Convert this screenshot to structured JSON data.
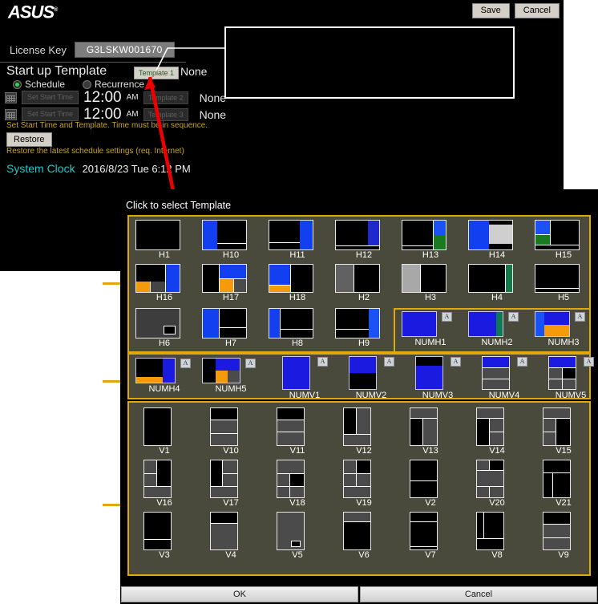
{
  "app": {
    "logo": "ASUS",
    "logo_tm": "®",
    "save_label": "Save",
    "cancel_label": "Cancel",
    "license_label": "License Key",
    "license_value": "G3LSKW001670",
    "startup_title": "Start up Template",
    "startup_template_button": "Template 1",
    "startup_template_value": "None",
    "schedule_label": "Schedule",
    "recurrence_label": "Recurrence",
    "rows": [
      {
        "set_start_time": "Set Start Time",
        "time": "12:00",
        "ampm": "AM",
        "template_button": "Template 2",
        "value": "None"
      },
      {
        "set_start_time": "Set Start Time",
        "time": "12:00",
        "ampm": "AM",
        "template_button": "Template 3",
        "value": "None"
      }
    ],
    "warn_schedule": "Set Start Time and Template. Time must be in sequence.",
    "restore_label": "Restore",
    "warn_restore": "Restore the latest schedule settings (req. Internet)",
    "system_clock_label": "System Clock",
    "system_clock_value": "2016/8/23  Tue  6:12 PM"
  },
  "picker": {
    "title": "Click to select Template",
    "ok_label": "OK",
    "cancel_label": "Cancel",
    "auto_badge": "A",
    "accent_color": "#e0a80b",
    "panel_bg": "#4a4a3c",
    "labels_row1": [
      "H1",
      "H10",
      "H11",
      "H12",
      "H13",
      "H14",
      "H15"
    ],
    "labels_row2": [
      "H16",
      "H17",
      "H18",
      "H2",
      "H3",
      "H4",
      "H5"
    ],
    "labels_row3": [
      "H6",
      "H7",
      "H8",
      "H9",
      "NUMH1",
      "NUMH2",
      "NUMH3"
    ],
    "labels_row4": [
      "NUMH4",
      "NUMH5",
      "NUMV1",
      "NUMV2",
      "NUMV3",
      "NUMV4",
      "NUMV5"
    ],
    "labels_row5": [
      "V1",
      "V10",
      "V11",
      "V12",
      "V13",
      "V14",
      "V15"
    ],
    "labels_row6": [
      "V16",
      "V17",
      "V18",
      "V19",
      "V2",
      "V20",
      "V21"
    ],
    "labels_row7": [
      "V3",
      "V4",
      "V5",
      "V6",
      "V7",
      "V8",
      "V9"
    ]
  }
}
